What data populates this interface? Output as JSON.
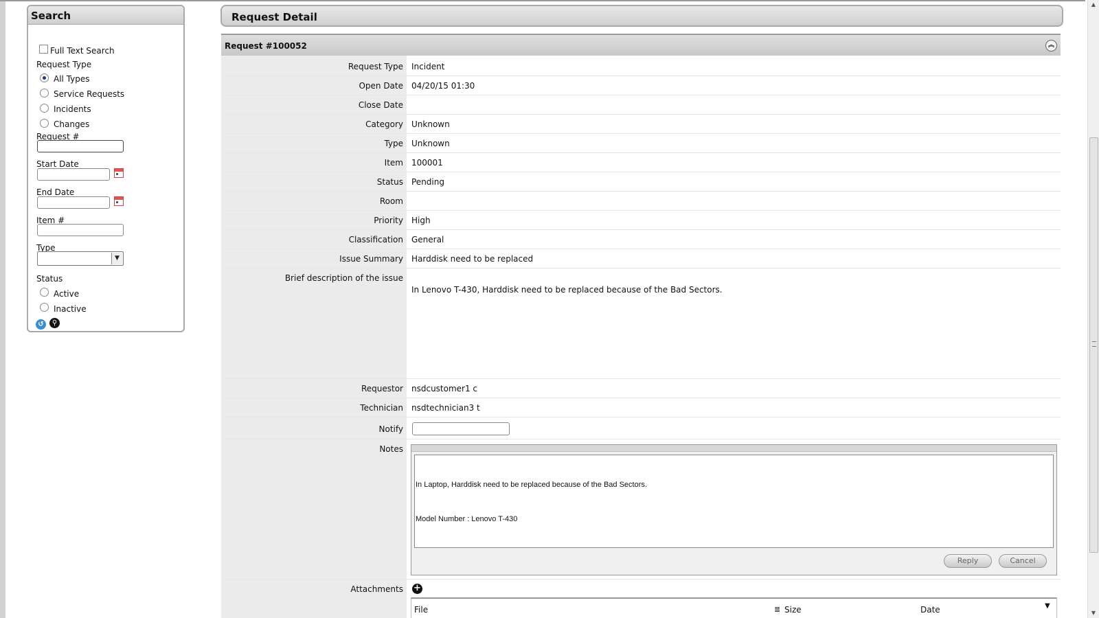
{
  "search": {
    "title": "Search",
    "full_text_label": "Full Text Search",
    "request_type_label": "Request Type",
    "request_types": [
      "All Types",
      "Service Requests",
      "Incidents",
      "Changes"
    ],
    "request_num_label": "Request #",
    "start_date_label": "Start Date",
    "end_date_label": "End Date",
    "item_num_label": "Item #",
    "type_label": "Type",
    "status_label": "Status",
    "status_options": [
      "Active",
      "Inactive"
    ]
  },
  "main": {
    "title": "Request Detail",
    "request_heading": "Request #100052",
    "fields": [
      {
        "label": "Request Type",
        "value": "Incident"
      },
      {
        "label": "Open Date",
        "value": "04/20/15 01:30"
      },
      {
        "label": "Close Date",
        "value": ""
      },
      {
        "label": "Category",
        "value": "Unknown"
      },
      {
        "label": "Type",
        "value": "Unknown"
      },
      {
        "label": "Item",
        "value": "100001"
      },
      {
        "label": "Status",
        "value": "Pending"
      },
      {
        "label": "Room",
        "value": ""
      },
      {
        "label": "Priority",
        "value": "High"
      },
      {
        "label": "Classification",
        "value": "General"
      },
      {
        "label": "Issue Summary",
        "value": "Harddisk need to be replaced"
      },
      {
        "label": "Brief description of the issue",
        "value": "In Lenovo T-430, Harddisk need to be replaced because of the Bad Sectors."
      },
      {
        "label": "Requestor",
        "value": "nsdcustomer1 c"
      },
      {
        "label": "Technician",
        "value": "nsdtechnician3 t"
      },
      {
        "label": "Notify",
        "value": ""
      },
      {
        "label": "Notes",
        "value": ""
      },
      {
        "label": "Attachments",
        "value": ""
      }
    ],
    "notes": {
      "line1": "In Laptop, Harddisk need to be replaced because of the Bad Sectors.",
      "line2": "Model Number : Lenovo T-430",
      "reply_label": "Reply",
      "cancel_label": "Cancel"
    },
    "attachments": {
      "columns": [
        "File",
        "Size",
        "Date"
      ]
    }
  }
}
